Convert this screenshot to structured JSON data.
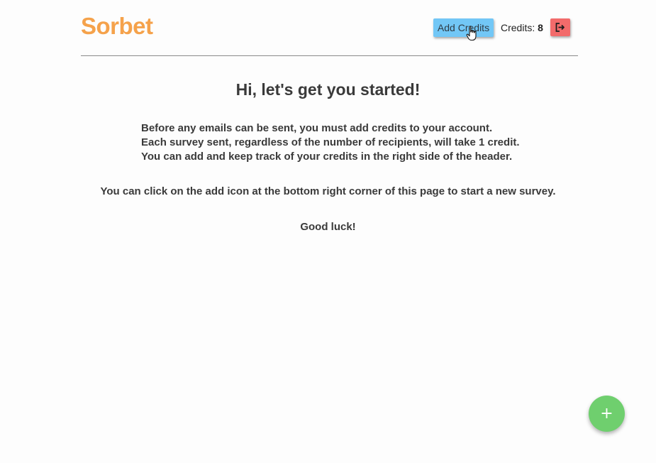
{
  "header": {
    "logo": "Sorbet",
    "add_credits_label": "Add Credits",
    "credits_label": "Credits:",
    "credits_value": "8",
    "logout_icon": "sign-out-icon"
  },
  "main": {
    "title": "Hi, let's get you started!",
    "intro_lines": [
      "Before any emails can be sent, you must add credits to your account.",
      "Each survey sent, regardless of the number of recipients, will take 1 credit.",
      "You can add and keep track of your credits in the right side of the header."
    ],
    "hint": "You can click on the add icon at the bottom right corner of this page to start a new survey.",
    "closing": "Good luck!"
  },
  "fab": {
    "label": "+",
    "icon": "add-icon"
  },
  "colors": {
    "brand": "#f5a24b",
    "add_credits": "#72c7f6",
    "logout": "#f26b6b",
    "fab": "#6fcf6e"
  }
}
